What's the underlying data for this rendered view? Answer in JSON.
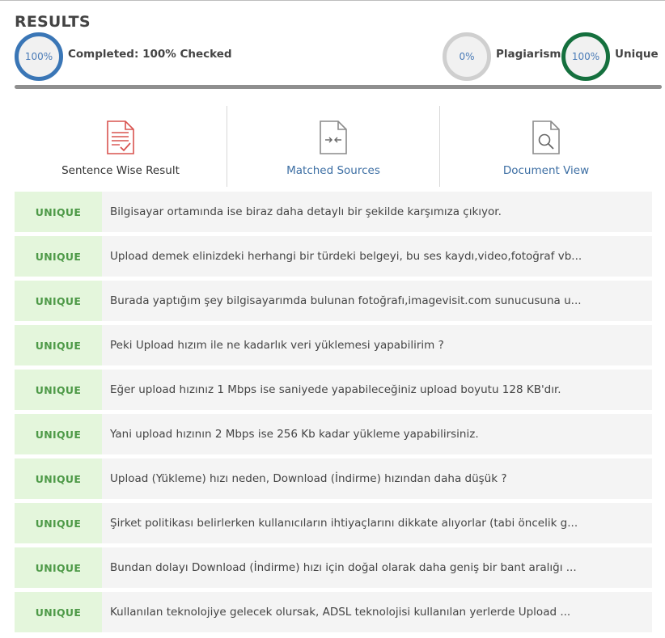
{
  "header": {
    "title": "RESULTS"
  },
  "stats": {
    "completed": {
      "circle_text": "100%",
      "label": "Completed: 100% Checked"
    },
    "plagiarism": {
      "circle_text": "0%",
      "label": "Plagiarism"
    },
    "unique": {
      "circle_text": "100%",
      "label": "Unique"
    }
  },
  "progress": {
    "fraction": 1.0
  },
  "colors": {
    "completed_ring": "#3a76b6",
    "plagiarism_ring": "#cfcfcf",
    "unique_ring": "#15703e",
    "unique_badge_bg": "#e4f6dc",
    "unique_badge_text": "#4e9a48",
    "link_blue": "#3c6ea3"
  },
  "tabs": [
    {
      "label": "Sentence Wise Result",
      "icon": "document-check-icon"
    },
    {
      "label": "Matched Sources",
      "icon": "document-compare-icon"
    },
    {
      "label": "Document View",
      "icon": "document-search-icon"
    }
  ],
  "results": [
    {
      "status": "UNIQUE",
      "text": "Bilgisayar ortamında ise biraz daha detaylı bir şekilde karşımıza çıkıyor."
    },
    {
      "status": "UNIQUE",
      "text": "Upload demek elinizdeki herhangi bir türdeki belgeyi, bu ses kaydı,video,fotoğraf vb..."
    },
    {
      "status": "UNIQUE",
      "text": "Burada yaptığım şey bilgisayarımda bulunan fotoğrafı,imagevisit.com sunucusuna u..."
    },
    {
      "status": "UNIQUE",
      "text": "Peki Upload hızım ile ne kadarlık veri yüklemesi yapabilirim ?"
    },
    {
      "status": "UNIQUE",
      "text": "Eğer upload hızınız 1 Mbps ise saniyede yapabileceğiniz upload boyutu 128 KB'dır."
    },
    {
      "status": "UNIQUE",
      "text": "Yani upload hızının 2 Mbps ise 256 Kb kadar yükleme yapabilirsiniz."
    },
    {
      "status": "UNIQUE",
      "text": "Upload (Yükleme) hızı neden, Download (İndirme) hızından daha düşük ?"
    },
    {
      "status": "UNIQUE",
      "text": "Şirket politikası belirlerken kullanıcıların ihtiyaçlarını dikkate alıyorlar (tabi öncelik g..."
    },
    {
      "status": "UNIQUE",
      "text": "Bundan dolayı Download (İndirme) hızı için doğal olarak daha geniş bir bant aralığı ..."
    },
    {
      "status": "UNIQUE",
      "text": "Kullanılan teknolojiye gelecek olursak, ADSL teknolojisi kullanılan yerlerde Upload ..."
    }
  ]
}
